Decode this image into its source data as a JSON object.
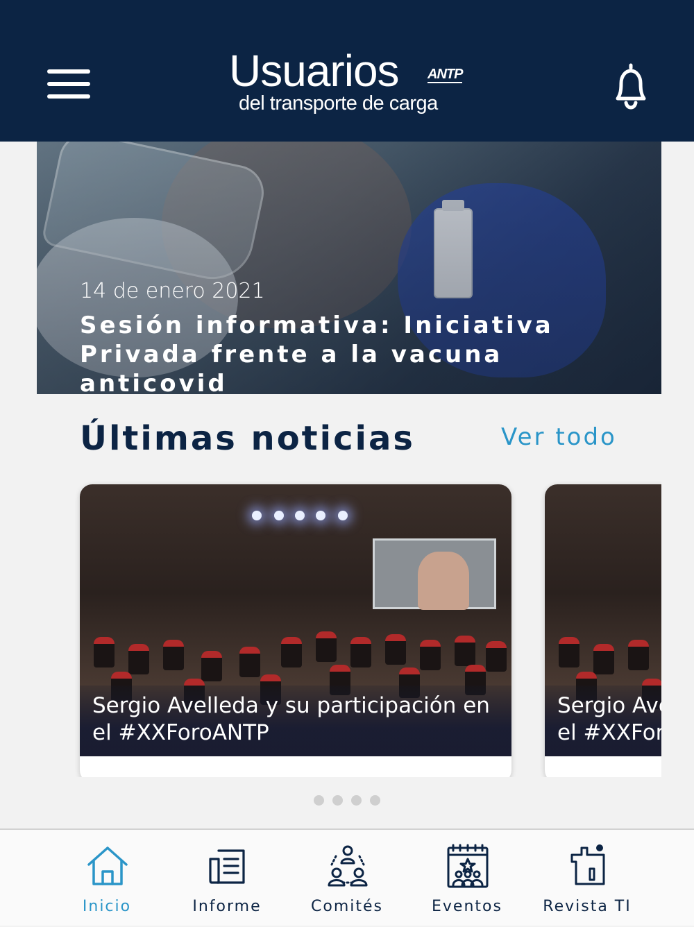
{
  "header": {
    "brand_main": "Usuarios",
    "brand_badge": "ANTP",
    "brand_sub": "del transporte de carga",
    "menu_icon": "hamburger-menu-icon",
    "notifications_icon": "bell-icon"
  },
  "hero": {
    "date": "14 de enero 2021",
    "title": "Sesión informativa: Iniciativa Privada frente a la vacuna anticovid"
  },
  "news": {
    "section_title": "Últimas noticias",
    "see_all_label": "Ver todo",
    "cards": [
      {
        "title": "Sergio Avelleda y su participación en el #XXForoANTP"
      },
      {
        "title": "Sergio Avelleda y su participación en el #XXForoANTP"
      }
    ],
    "pager_count": 4
  },
  "tabbar": {
    "items": [
      {
        "label": "Inicio",
        "icon": "home-icon",
        "active": true
      },
      {
        "label": "Informe",
        "icon": "document-icon",
        "active": false
      },
      {
        "label": "Comités",
        "icon": "committee-icon",
        "active": false
      },
      {
        "label": "Eventos",
        "icon": "calendar-event-icon",
        "active": false
      },
      {
        "label": "Revista TI",
        "icon": "magazine-ti-icon",
        "active": false
      }
    ]
  },
  "colors": {
    "header_bg": "#0c2444",
    "accent": "#2a95c8",
    "text_dark": "#0c2444",
    "background": "#f2f2f2"
  }
}
